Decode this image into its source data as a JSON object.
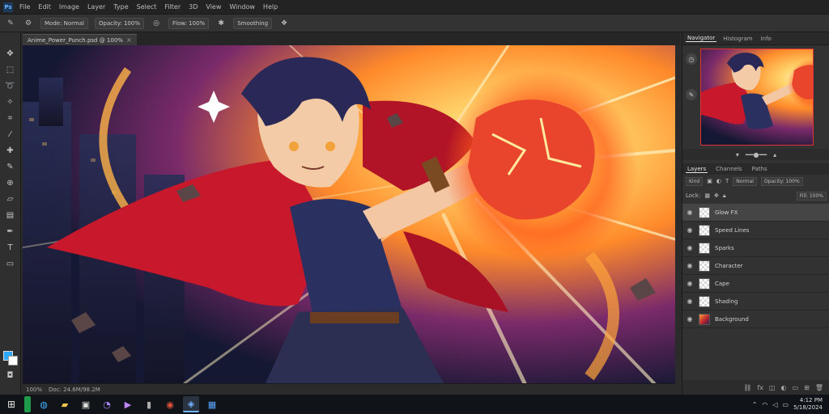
{
  "menubar": {
    "logo": "Ps",
    "items": [
      "File",
      "Edit",
      "Image",
      "Layer",
      "Type",
      "Select",
      "Filter",
      "3D",
      "View",
      "Window",
      "Help"
    ]
  },
  "options": {
    "items": [
      "Mode: Normal",
      "Opacity: 100%",
      "Flow: 100%",
      "Smoothing"
    ]
  },
  "document": {
    "tab_label": "Anime_Power_Punch.psd @ 100%",
    "close_glyph": "×"
  },
  "status": {
    "zoom": "100%",
    "doc_info": "Doc: 24.6M/98.2M"
  },
  "panels": {
    "top_tabs": [
      "Navigator",
      "Histogram",
      "Info"
    ],
    "layers_tabs": [
      "Layers",
      "Channels",
      "Paths"
    ],
    "kind_label": "Kind",
    "blend_mode": "Normal",
    "opacity": "Opacity: 100%",
    "lock_label": "Lock:",
    "fill": "Fill: 100%",
    "layers": [
      {
        "name": "Glow FX",
        "selected": true,
        "thumb": "transparent"
      },
      {
        "name": "Speed Lines",
        "selected": false,
        "thumb": "transparent"
      },
      {
        "name": "Sparks",
        "selected": false,
        "thumb": "transparent"
      },
      {
        "name": "Character",
        "selected": false,
        "thumb": "transparent"
      },
      {
        "name": "Cape",
        "selected": false,
        "thumb": "transparent"
      },
      {
        "name": "Shading",
        "selected": false,
        "thumb": "transparent"
      },
      {
        "name": "Background",
        "selected": false,
        "thumb": "art"
      }
    ]
  },
  "colors": {
    "foreground": "#2aa8ff",
    "background": "#ffffff",
    "accent": "#6fb4ff"
  },
  "taskbar": {
    "clock_time": "4:12 PM",
    "clock_date": "5/18/2024"
  }
}
